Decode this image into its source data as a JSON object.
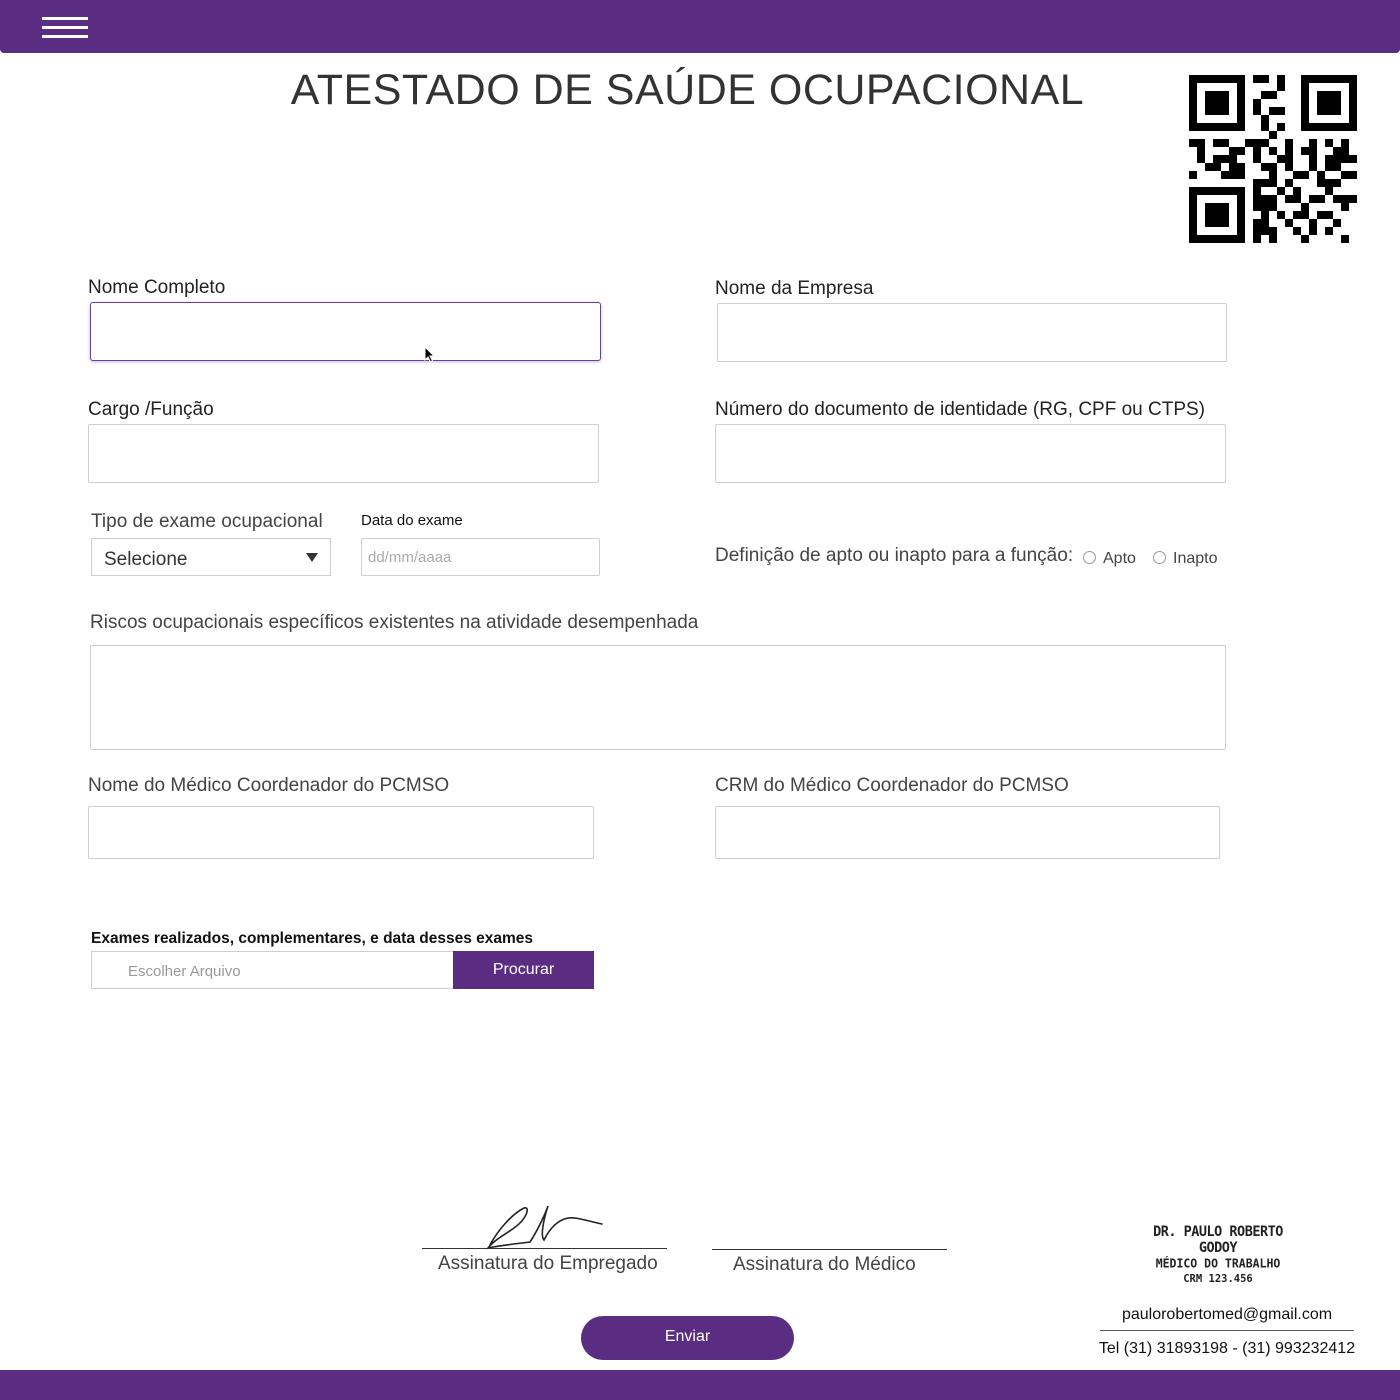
{
  "header": {
    "menu_icon": "hamburger-menu-icon"
  },
  "page": {
    "title": "ATESTADO DE SAÚDE OCUPACIONAL",
    "qr_icon": "qr-code-icon"
  },
  "form": {
    "nome_completo": {
      "label": "Nome Completo",
      "value": ""
    },
    "nome_empresa": {
      "label": "Nome da Empresa",
      "value": ""
    },
    "cargo": {
      "label": "Cargo /Função",
      "value": ""
    },
    "documento": {
      "label": "Número do documento de identidade (RG, CPF ou CTPS)",
      "value": ""
    },
    "tipo_exame": {
      "label": "Tipo de exame ocupacional",
      "selected": "Selecione"
    },
    "data_exame": {
      "label": "Data do exame",
      "placeholder": "dd/mm/aaaa",
      "value": ""
    },
    "apto": {
      "label": "Definição de apto ou inapto para a função:",
      "options": [
        "Apto",
        "Inapto"
      ]
    },
    "riscos": {
      "label": "Riscos ocupacionais específicos existentes na atividade desempenhada",
      "value": ""
    },
    "medico_nome": {
      "label": "Nome do Médico Coordenador do PCMSO",
      "value": ""
    },
    "medico_crm": {
      "label": "CRM do Médico Coordenador do PCMSO",
      "value": ""
    },
    "exames": {
      "label": "Exames realizados, complementares, e data desses exames",
      "file_placeholder": "Escolher Arquivo",
      "browse_label": "Procurar"
    }
  },
  "signatures": {
    "empregado": "Assinatura do Empregado",
    "medico": "Assinatura do Médico"
  },
  "stamp": {
    "line1": "DR. PAULO ROBERTO GODOY",
    "line2": "MÉDICO DO TRABALHO",
    "line3": "CRM 123.456"
  },
  "contact": {
    "email": "paulorobertomed@gmail.com",
    "tel": "Tel (31) 31893198 - (31) 993232412"
  },
  "submit_label": "Enviar",
  "colors": {
    "brand": "#5a2d82"
  }
}
